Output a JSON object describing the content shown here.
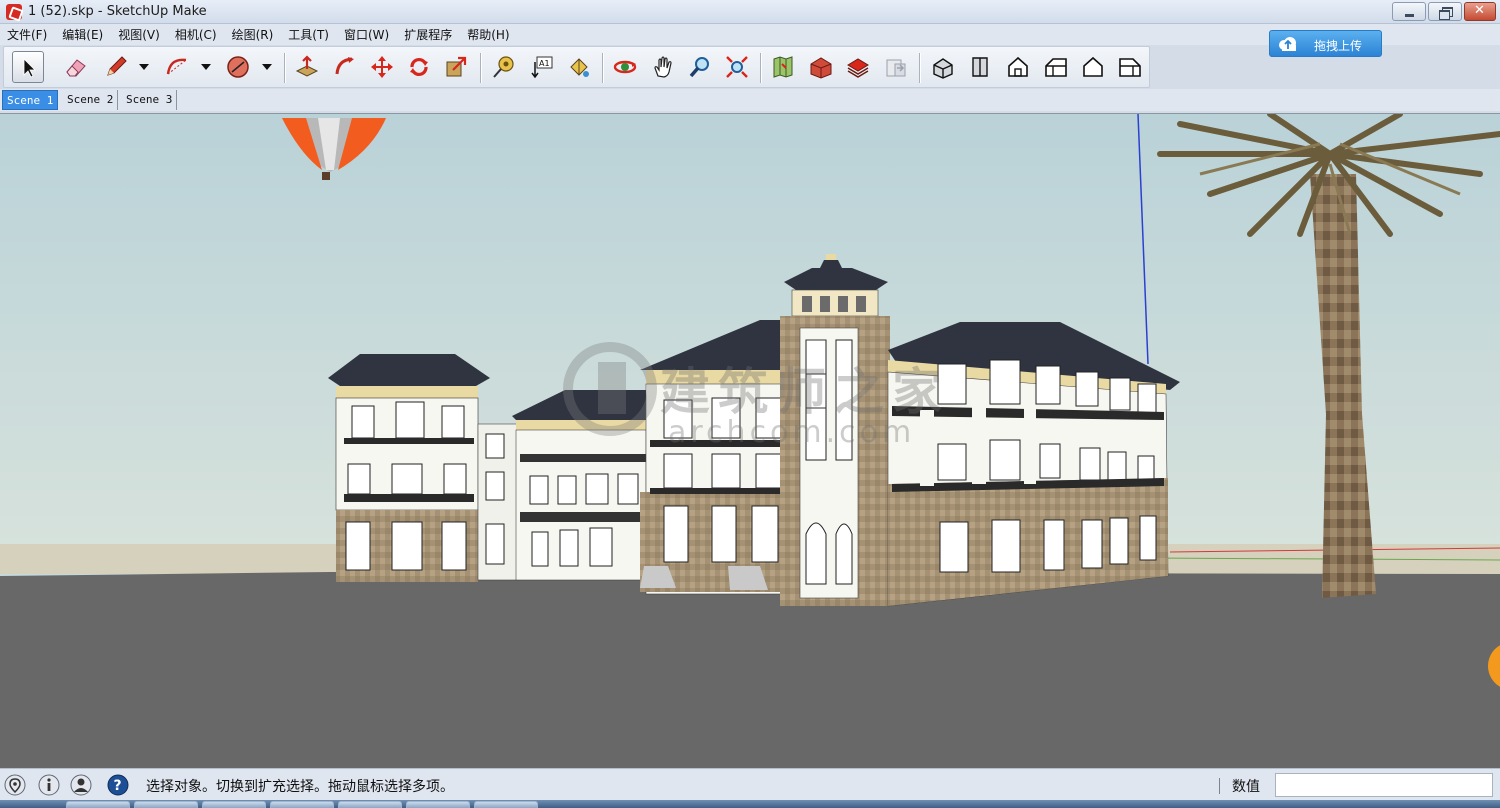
{
  "window": {
    "title": "1 (52).skp - SketchUp Make"
  },
  "menu": [
    "文件(F)",
    "编辑(E)",
    "视图(V)",
    "相机(C)",
    "绘图(R)",
    "工具(T)",
    "窗口(W)",
    "扩展程序",
    "帮助(H)"
  ],
  "upload_button": {
    "label": "拖拽上传",
    "icon": "cloud-upload-icon"
  },
  "toolbar": {
    "tools": [
      {
        "name": "select-tool",
        "icon": "arrow-cursor-icon",
        "active": true
      },
      {
        "name": "eraser-tool",
        "icon": "eraser-icon"
      },
      {
        "name": "pencil-tool",
        "icon": "pencil-icon"
      },
      {
        "name": "arc-tool",
        "icon": "arc-icon"
      },
      {
        "name": "shape-tool",
        "icon": "polygon-icon"
      },
      {
        "name": "push-pull-tool",
        "icon": "push-pull-icon"
      },
      {
        "name": "follow-me-tool",
        "icon": "follow-me-icon"
      },
      {
        "name": "move-tool",
        "icon": "move-arrows-icon"
      },
      {
        "name": "rotate-tool",
        "icon": "rotate-icon"
      },
      {
        "name": "scale-tool",
        "icon": "scale-icon"
      },
      {
        "name": "tape-measure-tool",
        "icon": "tape-measure-icon"
      },
      {
        "name": "text-tool",
        "icon": "text-label-icon"
      },
      {
        "name": "paint-bucket-tool",
        "icon": "paint-bucket-icon"
      },
      {
        "name": "orbit-tool",
        "icon": "orbit-icon"
      },
      {
        "name": "pan-tool",
        "icon": "hand-icon"
      },
      {
        "name": "zoom-tool",
        "icon": "magnifier-icon"
      },
      {
        "name": "zoom-extents-tool",
        "icon": "zoom-extents-icon"
      },
      {
        "name": "add-location-tool",
        "icon": "map-icon"
      },
      {
        "name": "3d-warehouse-tool",
        "icon": "warehouse-icon"
      },
      {
        "name": "extension-warehouse-tool",
        "icon": "extension-warehouse-icon"
      },
      {
        "name": "send-to-layout-tool",
        "icon": "layout-icon"
      },
      {
        "name": "iso-view",
        "icon": "iso-house-icon"
      },
      {
        "name": "top-view",
        "icon": "top-view-icon"
      },
      {
        "name": "front-view",
        "icon": "front-house-icon"
      },
      {
        "name": "right-view",
        "icon": "right-house-icon"
      },
      {
        "name": "back-view",
        "icon": "back-house-icon"
      },
      {
        "name": "left-view",
        "icon": "left-house-icon"
      }
    ]
  },
  "scenes": [
    {
      "label": "Scene 1",
      "active": true
    },
    {
      "label": "Scene 2",
      "active": false
    },
    {
      "label": "Scene 3",
      "active": false
    }
  ],
  "watermark": {
    "line1": "建筑师之家",
    "line2": "archcom.com"
  },
  "status": {
    "icons": [
      "geo-location-icon",
      "credits-icon",
      "user-icon",
      "help-icon"
    ],
    "message": "选择对象。切换到扩充选择。拖动鼠标选择多项。",
    "measurements_label": "数值",
    "measurements_value": ""
  },
  "colors": {
    "sky": "#c6d9dd",
    "ground": "#686868",
    "selection_blue": "#3a8ee6",
    "facade_white": "#f7f7f2",
    "stone": "#a89377",
    "roof": "#2f3440",
    "trim": "#e9d9a2"
  }
}
